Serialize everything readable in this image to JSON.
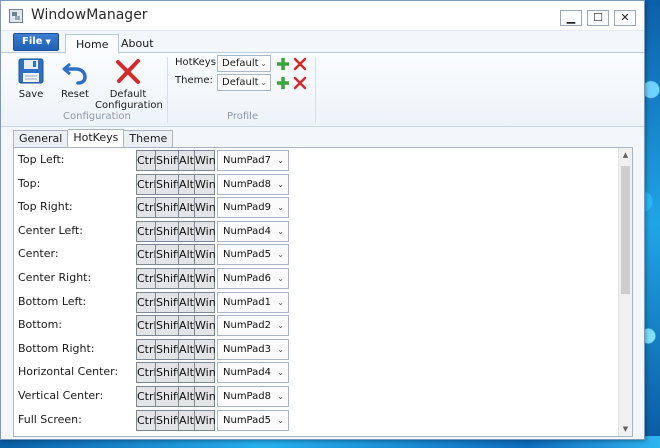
{
  "window": {
    "title": "WindowManager",
    "controls": {
      "minimize": "▁",
      "maximize": "☐",
      "close": "✕"
    }
  },
  "ribbon": {
    "file_label": "File",
    "tabs": [
      {
        "label": "Home",
        "active": true
      },
      {
        "label": "About",
        "active": false
      }
    ],
    "configuration": {
      "save_label": "Save",
      "reset_label": "Reset",
      "default_label_line1": "Default",
      "default_label_line2": "Configuration",
      "group_label": "Configuration"
    },
    "profile": {
      "hotkeys_label": "HotKeys:",
      "hotkeys_value": "Default",
      "theme_label": "Theme:",
      "theme_value": "Default",
      "group_label": "Profile"
    }
  },
  "content_tabs": [
    {
      "label": "General",
      "active": false
    },
    {
      "label": "HotKeys",
      "active": true
    },
    {
      "label": "Theme",
      "active": false
    }
  ],
  "modifier_labels": {
    "ctrl": "Ctrl",
    "shift": "Shift",
    "alt": "Alt",
    "win": "Win"
  },
  "hotkeys": [
    {
      "label": "Top Left:",
      "key": "NumPad7"
    },
    {
      "label": "Top:",
      "key": "NumPad8"
    },
    {
      "label": "Top Right:",
      "key": "NumPad9"
    },
    {
      "label": "Center Left:",
      "key": "NumPad4"
    },
    {
      "label": "Center:",
      "key": "NumPad5"
    },
    {
      "label": "Center Right:",
      "key": "NumPad6"
    },
    {
      "label": "Bottom Left:",
      "key": "NumPad1"
    },
    {
      "label": "Bottom:",
      "key": "NumPad2"
    },
    {
      "label": "Bottom Right:",
      "key": "NumPad3"
    },
    {
      "label": "Horizontal Center:",
      "key": "NumPad4"
    },
    {
      "label": "Vertical Center:",
      "key": "NumPad8"
    },
    {
      "label": "Full Screen:",
      "key": "NumPad5"
    }
  ],
  "icons": {
    "save": "save-icon",
    "reset": "undo-icon",
    "default": "red-x-icon",
    "add": "green-plus-icon",
    "delete": "red-x-icon"
  },
  "colors": {
    "accent": "#1f5fb4",
    "add_green": "#3aa53a",
    "delete_red": "#d32a2a"
  }
}
